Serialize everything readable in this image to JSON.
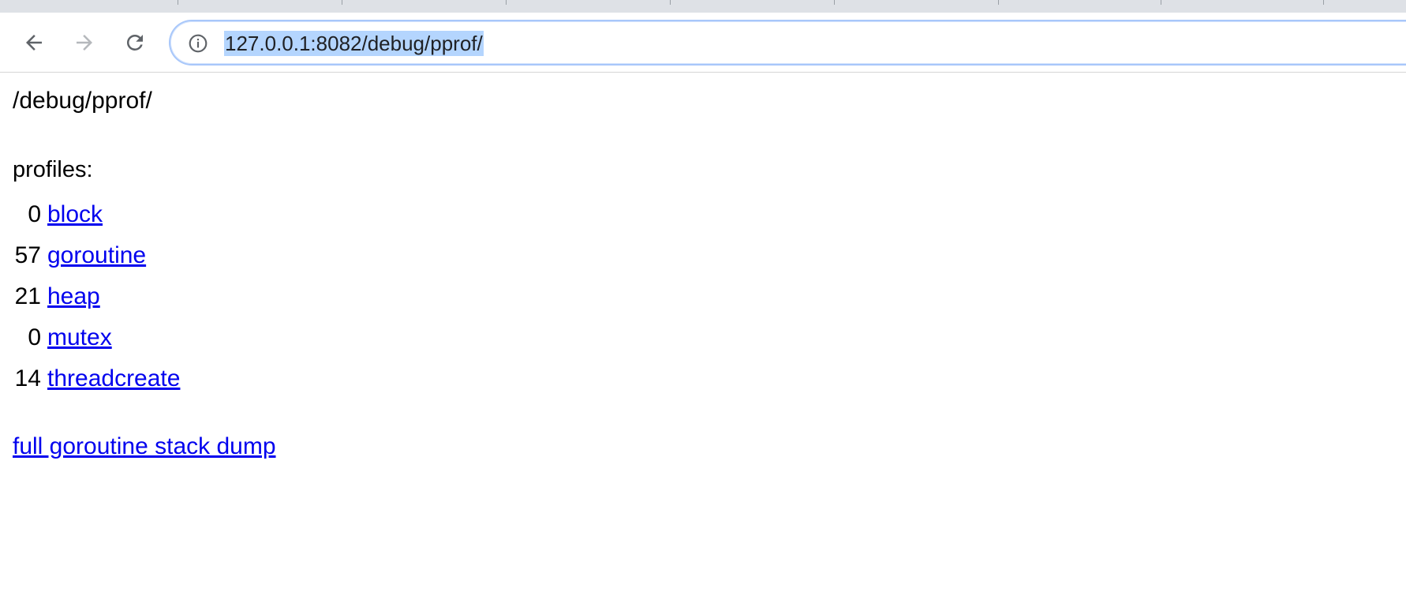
{
  "browser": {
    "url": "127.0.0.1:8082/debug/pprof/",
    "icons": {
      "back": "arrow-left-icon",
      "forward": "arrow-right-icon",
      "reload": "reload-icon",
      "site_info": "info-icon"
    }
  },
  "page": {
    "path": "/debug/pprof/",
    "profiles_label": "profiles:",
    "profiles": [
      {
        "count": "0",
        "name": "block"
      },
      {
        "count": "57",
        "name": "goroutine"
      },
      {
        "count": "21",
        "name": "heap"
      },
      {
        "count": "0",
        "name": "mutex"
      },
      {
        "count": "14",
        "name": "threadcreate"
      }
    ],
    "stack_dump_link": "full goroutine stack dump"
  },
  "colors": {
    "link": "#0000ee",
    "url_selection": "#b4d5fe",
    "omnibox_border": "#a8c7fa",
    "tabstrip": "#dee1e6"
  }
}
